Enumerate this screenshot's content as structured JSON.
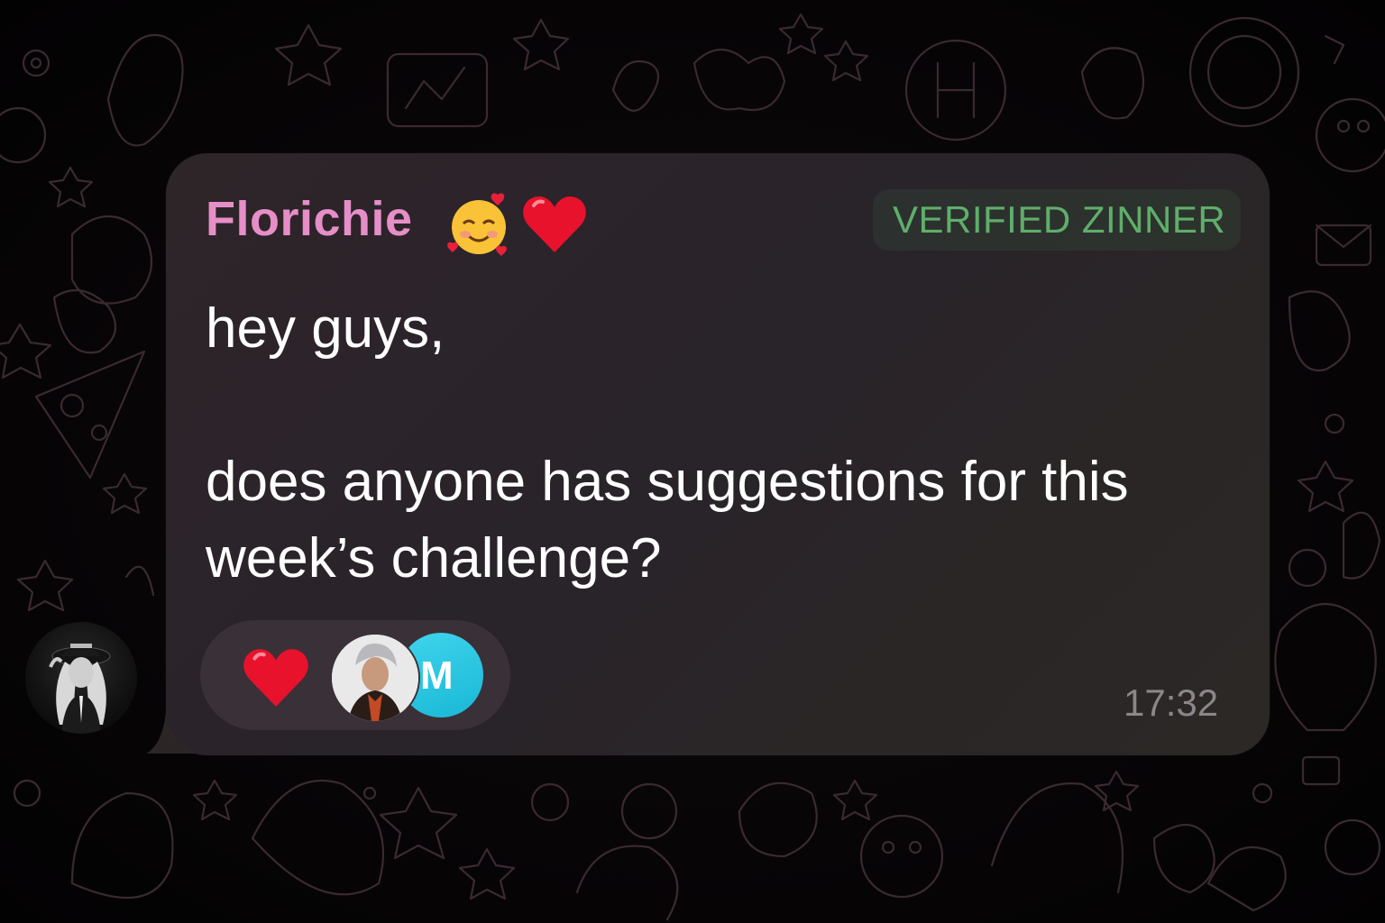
{
  "message": {
    "sender": "Florichie",
    "sender_emojis": [
      "smiling-face-with-hearts",
      "red-heart"
    ],
    "role_badge": "VERIFIED ZINNER",
    "text": "hey guys,\n\ndoes anyone has suggestions for this\nweek’s challenge?",
    "timestamp": "17:32",
    "reaction": {
      "emoji": "red-heart",
      "reactor_initial": "M"
    }
  },
  "colors": {
    "sender_name": "#e68ec8",
    "badge_text": "#5fae6a",
    "bubble": "#2b2428",
    "reaction_pill": "#3a3038",
    "reactor_avatar": "#1fbcd8",
    "timestamp": "#8d8589"
  }
}
